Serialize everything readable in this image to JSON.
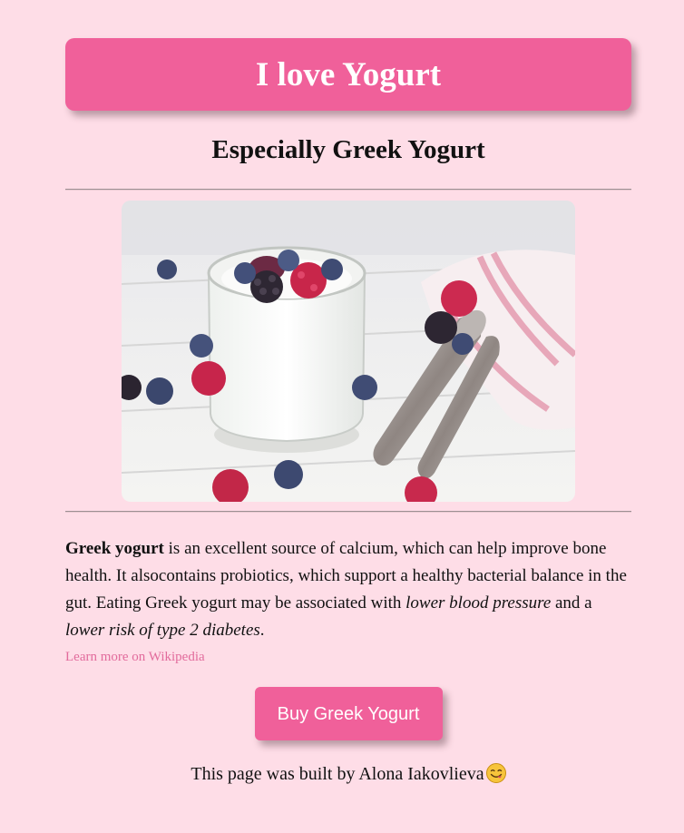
{
  "header": {
    "title": "I love Yogurt",
    "subtitle": "Especially Greek Yogurt"
  },
  "image": {
    "icon": "greek-yogurt-photo"
  },
  "description": {
    "bold_lead": "Greek yogurt",
    "text_1": " is an excellent source of calcium, which can help improve bone health. It alsocontains probiotics, which support a healthy bacterial balance in the gut. Eating Greek yogurt may be associated with ",
    "italic_1": "lower blood pressure",
    "text_2": " and a ",
    "italic_2": "lower risk of type 2 diabetes",
    "text_3": "."
  },
  "link": {
    "label": "Learn more on Wikipedia"
  },
  "cta": {
    "label": "Buy Greek Yogurt"
  },
  "footer": {
    "text": "This page was built by Alona Iakovlieva",
    "emoji_icon": "yum-face-emoji"
  },
  "colors": {
    "background": "#fedde7",
    "accent": "#f0609a",
    "link": "#e26b9c"
  }
}
